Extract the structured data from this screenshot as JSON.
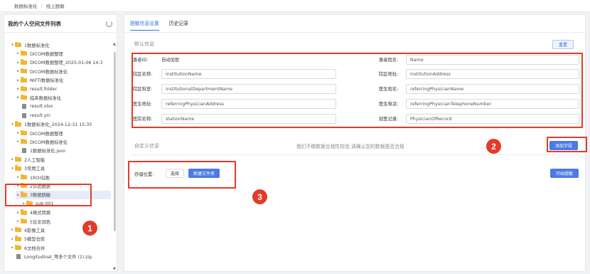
{
  "breadcrumb": {
    "root": "数据标准化",
    "sep": "/",
    "current": "线上脱敏"
  },
  "left_panel": {
    "title": "我的个人空间文件列表",
    "tree": [
      {
        "label": "1数据标准化",
        "type": "folder",
        "expanded": true
      },
      {
        "label": "DICOM数据整理",
        "type": "folder"
      },
      {
        "label": "DICOM数据整理_2025-01-06 14:3",
        "type": "folder"
      },
      {
        "label": "DICOM数据标准化",
        "type": "folder"
      },
      {
        "label": "NIFTI数据标准化",
        "type": "folder"
      },
      {
        "label": "result.folder",
        "type": "folder"
      },
      {
        "label": "临床数据标准化",
        "type": "folder"
      },
      {
        "label": "result.xlsx",
        "type": "file"
      },
      {
        "label": "result.yrc",
        "type": "file"
      },
      {
        "label": "1数据标准化_2024-12-31 15:35",
        "type": "folder",
        "expanded": true
      },
      {
        "label": "DICOM数据整理",
        "type": "folder"
      },
      {
        "label": "DICOM数据标准化",
        "type": "folder"
      },
      {
        "label": "1数据标准化.json",
        "type": "file"
      },
      {
        "label": "2人工智能",
        "type": "folder"
      },
      {
        "label": "3常用工具",
        "type": "folder",
        "expanded": true
      },
      {
        "label": "1ROI勾画",
        "type": "folder"
      },
      {
        "label": "2实验图表",
        "type": "folder"
      },
      {
        "label": "3数据脱敏",
        "type": "folder",
        "selected": true
      },
      {
        "label": "sub-001",
        "type": "folder"
      },
      {
        "label": "4格式转换",
        "type": "folder"
      },
      {
        "label": "5论文润色",
        "type": "folder"
      },
      {
        "label": "4影像工具",
        "type": "folder"
      },
      {
        "label": "5模型仓库",
        "type": "folder"
      },
      {
        "label": "6文档合并",
        "type": "folder"
      },
      {
        "label": "Longitudinal_等多个文件 (1).zip",
        "type": "file"
      }
    ]
  },
  "tabs": [
    {
      "label": "脱敏信息设置",
      "active": true
    },
    {
      "label": "历史记录",
      "active": false
    }
  ],
  "default_info": {
    "title": "默认信息",
    "reset_label": "重置",
    "patient_id_label": "患者ID:",
    "patient_id_value": "自动加密",
    "fields": [
      {
        "label": "患者姓名:",
        "value": "Name"
      },
      {
        "label": "院区名称:",
        "value": "institutionName"
      },
      {
        "label": "院区地址:",
        "value": "institutionAddress"
      },
      {
        "label": "院区科室:",
        "value": "institutionalDepartmentName"
      },
      {
        "label": "医生姓名:",
        "value": "referringPhysicianName"
      },
      {
        "label": "医生地址:",
        "value": "referringPhysicianAddress"
      },
      {
        "label": "医生电话:",
        "value": "referringPhysicianTelephoneNumber"
      },
      {
        "label": "医院名称:",
        "value": "stationName"
      },
      {
        "label": "就医记录:",
        "value": "PhysicianOfRecord"
      }
    ]
  },
  "custom_info": {
    "title": "自定义信息",
    "hint": "我们不做数据合规性校验,请确认您的数据是否合规",
    "add_field_label": "添加字段"
  },
  "storage": {
    "label": "存储位置:",
    "select_label": "选择",
    "new_folder_label": "新建文件夹",
    "start_label": "开始脱敏"
  },
  "annotations": [
    "1",
    "2",
    "3"
  ],
  "colors": {
    "accent": "#4a7be6",
    "annotation": "#e53a2a",
    "folder": "#f2b632"
  }
}
